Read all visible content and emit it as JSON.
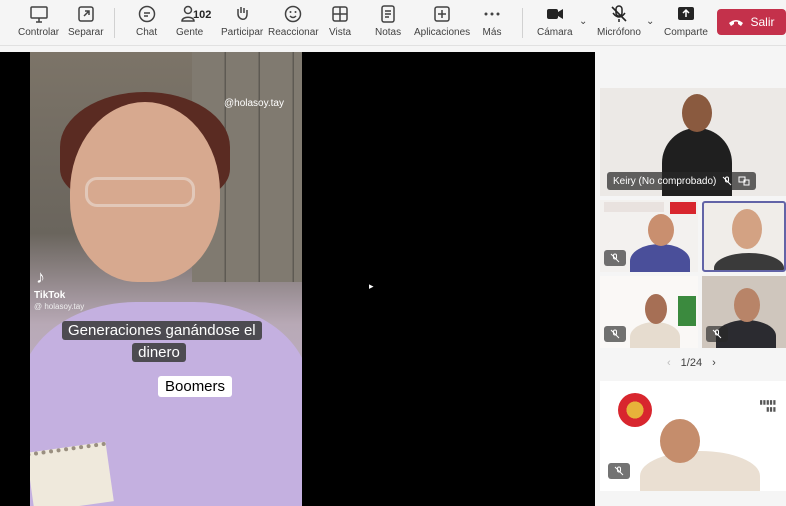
{
  "toolbar": {
    "controlar": "Controlar",
    "separar": "Separar",
    "chat": "Chat",
    "gente": "Gente",
    "gente_count": "102",
    "participar": "Participar",
    "reaccionar": "Reaccionar",
    "vista": "Vista",
    "notas": "Notas",
    "aplicaciones": "Aplicaciones",
    "mas": "Más",
    "camara": "Cámara",
    "microfono": "Micrófono",
    "comparte": "Comparte",
    "salir": "Salir"
  },
  "video": {
    "handle": "@holasoy.tay",
    "tiktok_name": "TikTok",
    "tiktok_handle": "@ holasoy.tay",
    "caption_1": "Generaciones ganándose el dinero",
    "caption_2": "Boomers"
  },
  "participants": {
    "featured_label": "Keiry (No comprobado)",
    "pager": "1/24"
  },
  "colors": {
    "leave_red": "#c4314b",
    "active_border": "#6264a7"
  }
}
